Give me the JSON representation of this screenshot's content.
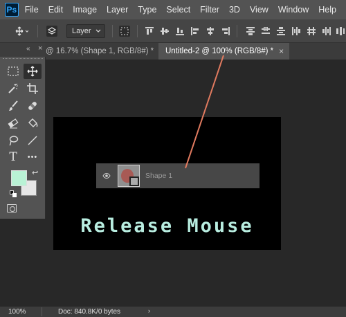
{
  "app": {
    "logo": "Ps"
  },
  "menu": [
    "File",
    "Edit",
    "Image",
    "Layer",
    "Type",
    "Select",
    "Filter",
    "3D",
    "View",
    "Window",
    "Help"
  ],
  "options_bar": {
    "auto_select_target": "Layer",
    "icons": [
      "move-tool-icon",
      "auto-select-icon",
      "chevron-down-icon",
      "transform-controls-icon",
      "align-top-icon",
      "align-vcenter-icon",
      "align-bottom-icon",
      "align-left-icon",
      "align-hcenter-icon",
      "align-right-icon",
      "distribute-top-icon",
      "distribute-vcenter-icon",
      "distribute-bottom-icon",
      "distribute-left-icon"
    ]
  },
  "tabs": [
    {
      "label": "@ 16.7% (Shape 1, RGB/8#) *",
      "close": "×",
      "active": false
    },
    {
      "label": "Untitled-2 @ 100% (RGB/8#) *",
      "close": "×",
      "active": true
    }
  ],
  "tools_panel": {
    "collapse": "«",
    "close": "×",
    "tools": [
      "marquee-tool",
      "move-tool",
      "magic-wand-tool",
      "crop-tool",
      "brush-tool",
      "healing-brush-tool",
      "eraser-tool",
      "paint-bucket-tool",
      "lasso-tool",
      "line-tool",
      "type-tool",
      "more-tools"
    ],
    "more_label": "•••",
    "type_label": "T",
    "swap": "↩",
    "foreground_color": "#b9f2d5",
    "background_color": "#e6e6e6"
  },
  "drag_layer": {
    "name": "Shape 1"
  },
  "canvas": {
    "text": "Release Mouse",
    "text_color": "#b8ede0",
    "background": "#000000"
  },
  "annotation": {
    "arrow_color": "#e07a5f"
  },
  "status": {
    "zoom": "100%",
    "doc": "Doc: 840.8K/0 bytes",
    "caret": "›"
  }
}
